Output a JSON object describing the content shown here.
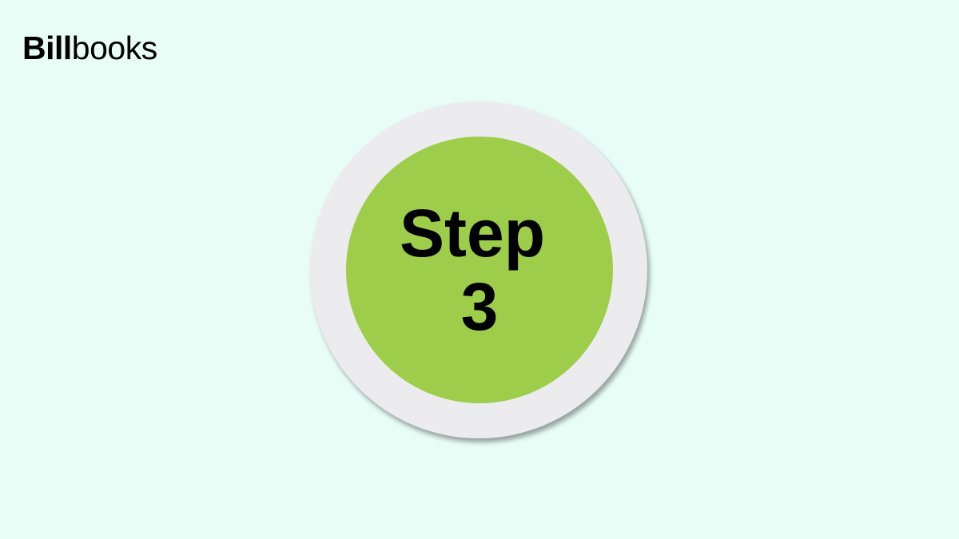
{
  "brand": {
    "logo_bold": "Bill",
    "logo_light": "books"
  },
  "badge": {
    "line1": "Step",
    "line2": "3"
  },
  "colors": {
    "background": "#e8fdf6",
    "ring": "#ececee",
    "disc": "#9ecc4b",
    "text": "#000000"
  }
}
